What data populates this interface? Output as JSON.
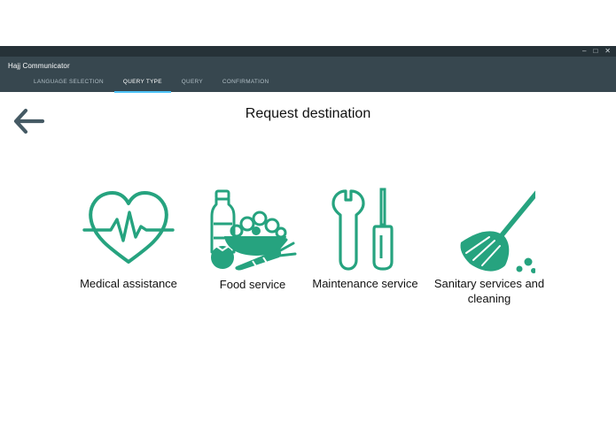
{
  "window": {
    "title": "Hajj Communicator",
    "controls": {
      "minimize": "–",
      "maximize": "□",
      "close": "✕"
    }
  },
  "tabs": [
    {
      "label": "LANGUAGE SELECTION",
      "active": false
    },
    {
      "label": "QUERY TYPE",
      "active": true
    },
    {
      "label": "QUERY",
      "active": false
    },
    {
      "label": "CONFIRMATION",
      "active": false
    }
  ],
  "page": {
    "title": "Request destination",
    "back_icon": "arrow-left-icon"
  },
  "options": [
    {
      "label": "Medical assistance",
      "icon": "heart-pulse-icon"
    },
    {
      "label": "Food service",
      "icon": "food-icon"
    },
    {
      "label": "Maintenance service",
      "icon": "wrench-screwdriver-icon"
    },
    {
      "label": "Sanitary services and cleaning",
      "icon": "broom-icon"
    }
  ],
  "colors": {
    "titlebar": "#263238",
    "appbar": "#37474f",
    "tab_indicator": "#4fc3f7",
    "icon_accent": "#26a37f",
    "back_arrow": "#455a64"
  }
}
